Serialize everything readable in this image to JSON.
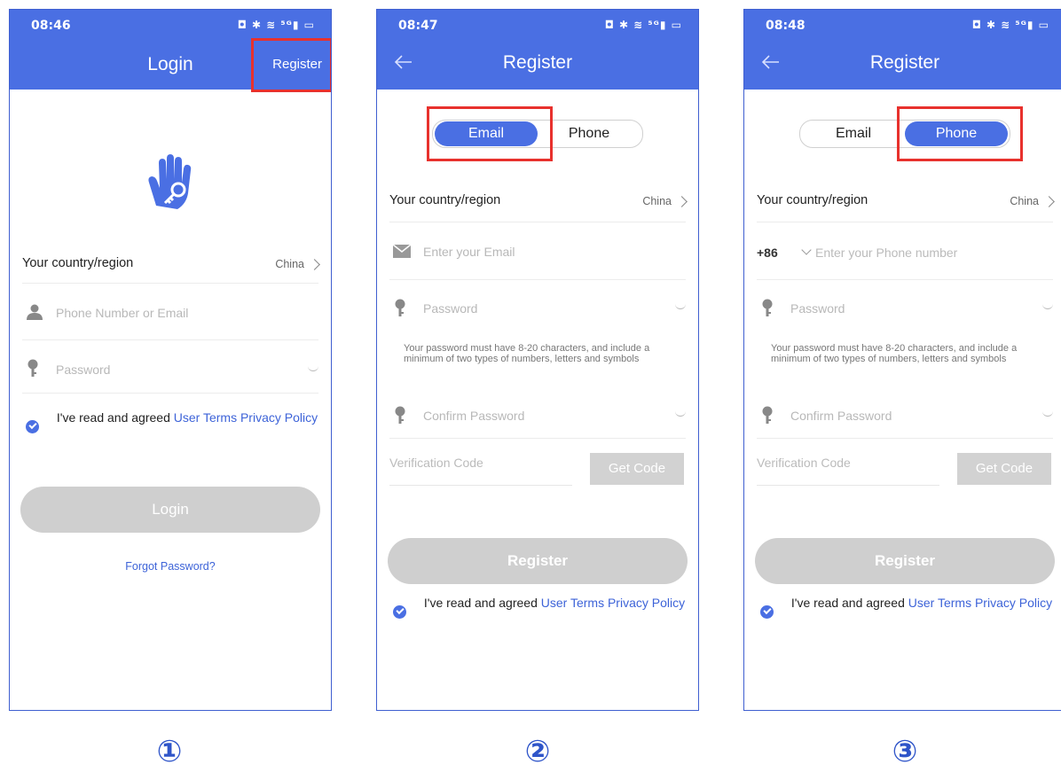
{
  "status": {
    "icons": "◘ ✱ ≋ ⁵ᴳ▮ ▭"
  },
  "screen1": {
    "time": "08:46",
    "title": "Login",
    "register_link": "Register",
    "country_label": "Your country/region",
    "country_value": "China",
    "account_placeholder": "Phone Number or Email",
    "password_placeholder": "Password",
    "agree_prefix": "I've read and agreed",
    "terms": "User Terms",
    "privacy": "Privacy Policy",
    "login_button": "Login",
    "forgot": "Forgot Password?",
    "step": "①"
  },
  "screen2": {
    "time": "08:47",
    "title": "Register",
    "tab_email": "Email",
    "tab_phone": "Phone",
    "active_tab": "Email",
    "country_label": "Your country/region",
    "country_value": "China",
    "email_placeholder": "Enter your Email",
    "password_placeholder": "Password",
    "password_hint": "Your password must have 8-20 characters, and include a minimum of two types of numbers, letters and symbols",
    "confirm_placeholder": "Confirm Password",
    "code_placeholder": "Verification Code",
    "get_code": "Get Code",
    "register_button": "Register",
    "agree_prefix": "I've read and agreed",
    "terms": "User Terms",
    "privacy": "Privacy Policy",
    "step": "②"
  },
  "screen3": {
    "time": "08:48",
    "title": "Register",
    "tab_email": "Email",
    "tab_phone": "Phone",
    "active_tab": "Phone",
    "country_label": "Your country/region",
    "country_value": "China",
    "country_code": "+86",
    "phone_placeholder": "Enter your Phone number",
    "password_placeholder": "Password",
    "password_hint": "Your password must have 8-20 characters, and include a minimum of two types of numbers, letters and symbols",
    "confirm_placeholder": "Confirm Password",
    "code_placeholder": "Verification Code",
    "get_code": "Get Code",
    "register_button": "Register",
    "agree_prefix": "I've read and agreed",
    "terms": "User Terms",
    "privacy": "Privacy Policy",
    "step": "③"
  },
  "colors": {
    "brand": "#4a6fe3",
    "highlight": "#e8312d",
    "link": "#3d63d8",
    "disabled": "#cfcfcf"
  }
}
